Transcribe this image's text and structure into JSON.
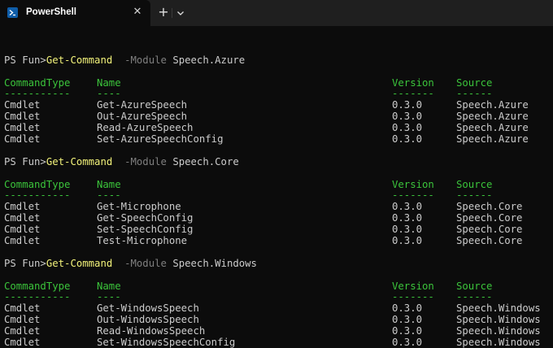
{
  "window": {
    "tab_title": "PowerShell",
    "new_tab_glyph": "+",
    "close_glyph": "✕",
    "icons": {
      "tab": "powershell-icon",
      "close": "close-icon",
      "new_tab": "plus-icon",
      "dropdown": "chevron-down-icon"
    },
    "colors": {
      "background": "#0c0c0c",
      "titlebar": "#1f1f1f",
      "command": "#f2f27a",
      "header": "#3bc43b",
      "parameter": "#7f7f7f",
      "text": "#cccccc"
    }
  },
  "blocks": [
    {
      "prompt": {
        "prefix": "PS Fun>",
        "command": "Get-Command",
        "param": "-Module",
        "arg": "Speech.Azure"
      },
      "headers": [
        "CommandType",
        "Name",
        "Version",
        "Source"
      ],
      "dashes": [
        "-----------",
        "----",
        "-------",
        "------"
      ],
      "rows": [
        [
          "Cmdlet",
          "Get-AzureSpeech",
          "0.3.0",
          "Speech.Azure"
        ],
        [
          "Cmdlet",
          "Out-AzureSpeech",
          "0.3.0",
          "Speech.Azure"
        ],
        [
          "Cmdlet",
          "Read-AzureSpeech",
          "0.3.0",
          "Speech.Azure"
        ],
        [
          "Cmdlet",
          "Set-AzureSpeechConfig",
          "0.3.0",
          "Speech.Azure"
        ]
      ]
    },
    {
      "prompt": {
        "prefix": "PS Fun>",
        "command": "Get-Command",
        "param": "-Module",
        "arg": "Speech.Core"
      },
      "headers": [
        "CommandType",
        "Name",
        "Version",
        "Source"
      ],
      "dashes": [
        "-----------",
        "----",
        "-------",
        "------"
      ],
      "rows": [
        [
          "Cmdlet",
          "Get-Microphone",
          "0.3.0",
          "Speech.Core"
        ],
        [
          "Cmdlet",
          "Get-SpeechConfig",
          "0.3.0",
          "Speech.Core"
        ],
        [
          "Cmdlet",
          "Set-SpeechConfig",
          "0.3.0",
          "Speech.Core"
        ],
        [
          "Cmdlet",
          "Test-Microphone",
          "0.3.0",
          "Speech.Core"
        ]
      ]
    },
    {
      "prompt": {
        "prefix": "PS Fun>",
        "command": "Get-Command",
        "param": "-Module",
        "arg": "Speech.Windows"
      },
      "headers": [
        "CommandType",
        "Name",
        "Version",
        "Source"
      ],
      "dashes": [
        "-----------",
        "----",
        "-------",
        "------"
      ],
      "rows": [
        [
          "Cmdlet",
          "Get-WindowsSpeech",
          "0.3.0",
          "Speech.Windows"
        ],
        [
          "Cmdlet",
          "Out-WindowsSpeech",
          "0.3.0",
          "Speech.Windows"
        ],
        [
          "Cmdlet",
          "Read-WindowsSpeech",
          "0.3.0",
          "Speech.Windows"
        ],
        [
          "Cmdlet",
          "Set-WindowsSpeechConfig",
          "0.3.0",
          "Speech.Windows"
        ]
      ]
    }
  ]
}
